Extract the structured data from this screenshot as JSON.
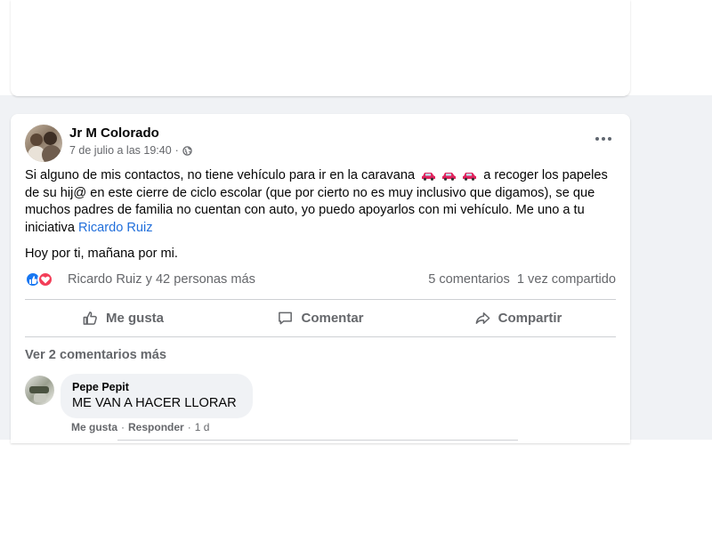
{
  "post": {
    "author": "Jr M Colorado",
    "timestamp": "7 de julio a las 19:40",
    "separator": "·",
    "body_pre": "Si alguno de mis contactos, no tiene vehículo para ir en la caravana",
    "body_post": "a recoger los papeles de su hij@ en este cierre de ciclo escolar (que por cierto no es muy inclusivo que digamos), se que muchos padres de familia no cuentan con auto, yo puedo apoyarlos con mi vehículo. Me uno a tu iniciativa",
    "mention": "Ricardo Ruiz",
    "body_second": "Hoy por ti, mañana por mi."
  },
  "reactions": {
    "reactors": "Ricardo Ruiz y 42 personas más",
    "comments_count": "5 comentarios",
    "shares_count": "1 vez compartido"
  },
  "actions": {
    "like": "Me gusta",
    "comment": "Comentar",
    "share": "Compartir"
  },
  "comments": {
    "view_more": "Ver 2 comentarios más",
    "items": [
      {
        "author": "Pepe Pepit",
        "text": "ME VAN A HACER LLORAR",
        "like_label": "Me gusta",
        "dot": "·",
        "reply_label": "Responder",
        "time": "1 d"
      }
    ]
  },
  "colors": {
    "link": "#216fdb",
    "secondary_text": "#65676b",
    "like_blue": "#1877f2",
    "love_red": "#f33e58",
    "car_red": "#e0245e",
    "feed_background": "#f0f2f5"
  },
  "icons": {
    "globe": "globe-icon",
    "more": "more-options-icon",
    "like": "thumbs-up-icon",
    "comment": "comment-icon",
    "share": "share-arrow-icon",
    "car": "red-car-emoji"
  }
}
